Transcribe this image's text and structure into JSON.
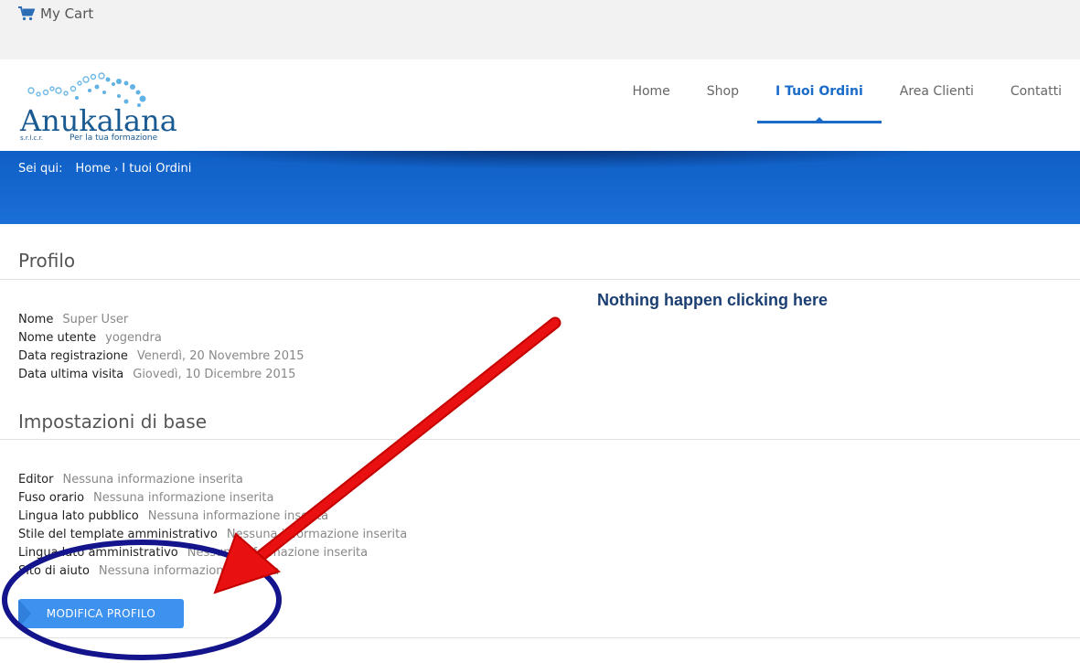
{
  "topbar": {
    "cart_label": "My Cart"
  },
  "logo": {
    "name": "Anukalana",
    "sub_left": "s.r.l.c.r.",
    "sub_right": "Per la tua formazione"
  },
  "nav": {
    "items": [
      {
        "label": "Home",
        "active": false
      },
      {
        "label": "Shop",
        "active": false
      },
      {
        "label": "I Tuoi Ordini",
        "active": true
      },
      {
        "label": "Area Clienti",
        "active": false
      },
      {
        "label": "Contatti",
        "active": false
      }
    ]
  },
  "breadcrumb": {
    "label": "Sei qui:",
    "home": "Home",
    "current": "I tuoi Ordini"
  },
  "profile": {
    "title": "Profilo",
    "fields": [
      {
        "key": "Nome",
        "value": "Super User"
      },
      {
        "key": "Nome utente",
        "value": "yogendra"
      },
      {
        "key": "Data registrazione",
        "value": "Venerdì, 20 Novembre 2015"
      },
      {
        "key": "Data ultima visita",
        "value": "Giovedì, 10 Dicembre 2015"
      }
    ]
  },
  "basic_settings": {
    "title": "Impostazioni di base",
    "fields": [
      {
        "key": "Editor",
        "value": "Nessuna informazione inserita"
      },
      {
        "key": "Fuso orario",
        "value": "Nessuna informazione inserita"
      },
      {
        "key": "Lingua lato pubblico",
        "value": "Nessuna informazione inserita"
      },
      {
        "key": "Stile del template amministrativo",
        "value": "Nessuna informazione inserita"
      },
      {
        "key": "Lingua lato amministrativo",
        "value": "Nessuna informazione inserita"
      },
      {
        "key": "Sito di aiuto",
        "value": "Nessuna informazione inserita"
      }
    ]
  },
  "edit_button": {
    "label": "MODIFICA PROFILO"
  },
  "annotation": {
    "text": "Nothing happen clicking here",
    "arrow_color": "#e81010",
    "ellipse_color": "#14148c"
  },
  "colors": {
    "accent": "#1a6cc8",
    "banner": "#1468d2",
    "button": "#3d92f0"
  }
}
